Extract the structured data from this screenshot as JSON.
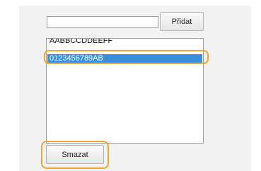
{
  "add_form": {
    "input_value": "",
    "add_label": "Přidat"
  },
  "list": {
    "items": [
      {
        "label": "AABBCCDDEEFF"
      },
      {
        "label": "0123456789AB"
      }
    ],
    "selected_index": 1
  },
  "actions": {
    "delete_label": "Smazat"
  },
  "colors": {
    "selection": "#3c8fdc",
    "callout": "#f0a43a"
  }
}
